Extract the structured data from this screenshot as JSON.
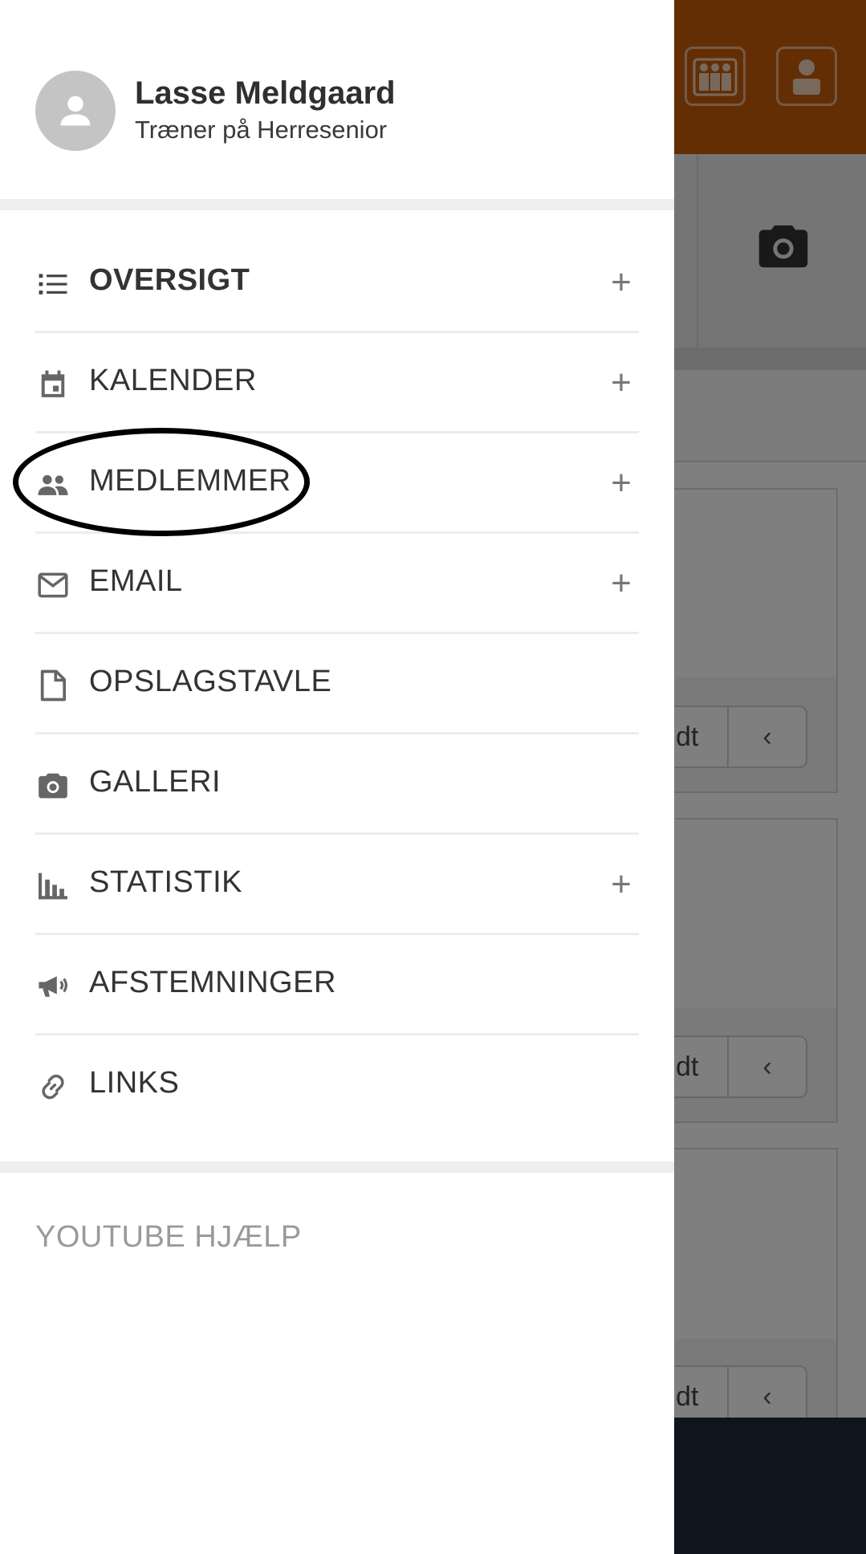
{
  "header": {
    "user_name": "Lasse Meldgaard",
    "user_role": "Træner på Herresenior",
    "avatar_icon": "person-icon"
  },
  "menu": {
    "items": [
      {
        "label": "OVERSIGT",
        "icon": "list-icon",
        "expandable": true,
        "active": true
      },
      {
        "label": "KALENDER",
        "icon": "calendar-icon",
        "expandable": true
      },
      {
        "label": "MEDLEMMER",
        "icon": "people-icon",
        "expandable": true
      },
      {
        "label": "EMAIL",
        "icon": "envelope-icon",
        "expandable": true
      },
      {
        "label": "OPSLAGSTAVLE",
        "icon": "document-icon",
        "expandable": false
      },
      {
        "label": "GALLERI",
        "icon": "camera-icon",
        "expandable": false
      },
      {
        "label": "STATISTIK",
        "icon": "bar-chart-icon",
        "expandable": true
      },
      {
        "label": "AFSTEMNINGER",
        "icon": "megaphone-icon",
        "expandable": false
      },
      {
        "label": "LINKS",
        "icon": "link-icon",
        "expandable": false
      }
    ],
    "plus_symbol": "+"
  },
  "footer": {
    "youtube_help": "YOUTUBE HJÆLP"
  },
  "background": {
    "button_partial_label": "dt",
    "back_symbol": "‹"
  },
  "colors": {
    "accent_header": "#c95c0b",
    "drawer_bg": "#ffffff",
    "text": "#333333",
    "muted_text": "#9a9a9a",
    "highlight": "#000000"
  }
}
